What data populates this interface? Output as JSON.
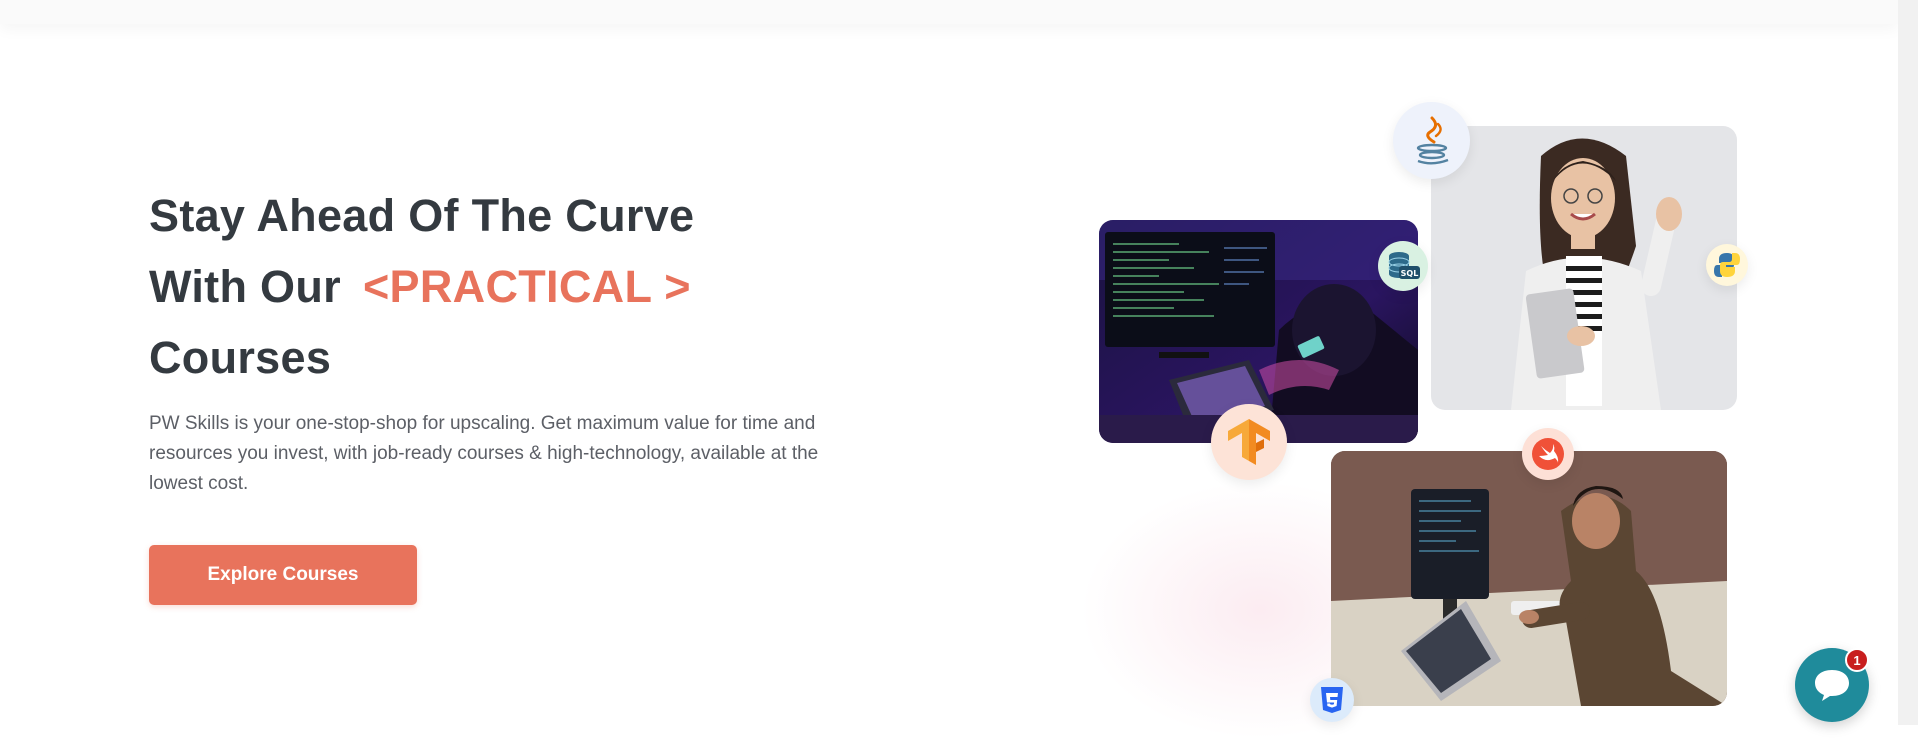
{
  "hero": {
    "headline_line1": "Stay Ahead Of The Curve",
    "headline_line2_prefix": "With Our",
    "headline_highlight": "<PRACTICAL >",
    "headline_line3": "Courses",
    "description": "PW Skills is your one-stop-shop for upscaling. Get maximum value for time and resources you invest, with job-ready courses & high-technology, available at the lowest cost.",
    "cta_label": "Explore Courses"
  },
  "tech_badges": {
    "sql_text": "SQL"
  },
  "chat": {
    "unread_count": "1"
  },
  "colors": {
    "accent": "#e8735c",
    "heading": "#343a40",
    "body_text": "#5c5f66",
    "chat_button": "#1f8b9b",
    "notification": "#c81e1e"
  },
  "icons": [
    "java-icon",
    "sql-database-icon",
    "python-icon",
    "tensorflow-icon",
    "swift-icon",
    "css3-icon",
    "chat-bubble-icon"
  ]
}
